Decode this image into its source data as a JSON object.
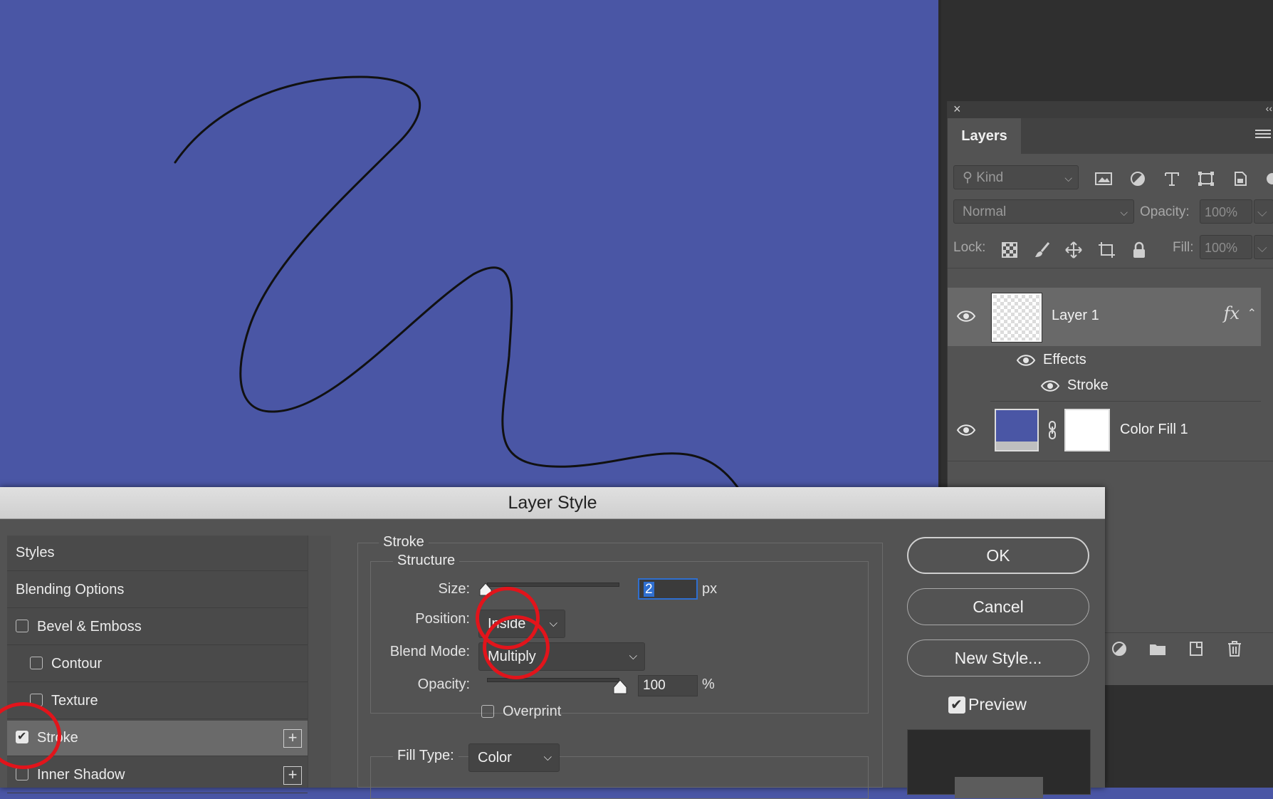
{
  "canvas": {
    "background": "#4a56a5",
    "stroke_color": "#111111"
  },
  "layers_panel": {
    "tab_label": "Layers",
    "filter_kind": "Kind",
    "blend_mode": "Normal",
    "opacity_label": "Opacity:",
    "opacity_value": "100%",
    "lock_label": "Lock:",
    "fill_label": "Fill:",
    "fill_value": "100%",
    "layers": [
      {
        "name": "Layer 1",
        "fx": "fx",
        "effects_label": "Effects",
        "effect_name": "Stroke"
      },
      {
        "name": "Color Fill 1",
        "fill_color": "#4a56a5"
      }
    ]
  },
  "dialog": {
    "title": "Layer Style",
    "styles_list": [
      {
        "label": "Styles"
      },
      {
        "label": "Blending Options"
      },
      {
        "label": "Bevel & Emboss",
        "checked": false
      },
      {
        "label": "Contour",
        "checked": false
      },
      {
        "label": "Texture",
        "checked": false
      },
      {
        "label": "Stroke",
        "checked": true,
        "selected": true
      },
      {
        "label": "Inner Shadow",
        "checked": false
      }
    ],
    "stroke": {
      "group_label": "Stroke",
      "structure_label": "Structure",
      "size_label": "Size:",
      "size_value": "2",
      "size_unit": "px",
      "position_label": "Position:",
      "position_value": "Inside",
      "blend_mode_label": "Blend Mode:",
      "blend_mode_value": "Multiply",
      "opacity_label": "Opacity:",
      "opacity_value": "100",
      "opacity_unit": "%",
      "overprint_label": "Overprint",
      "fill_type_label": "Fill Type:",
      "fill_type_value": "Color"
    },
    "buttons": {
      "ok": "OK",
      "cancel": "Cancel",
      "new_style": "New Style..."
    },
    "preview_label": "Preview",
    "highlight_color": "#e2141b"
  }
}
